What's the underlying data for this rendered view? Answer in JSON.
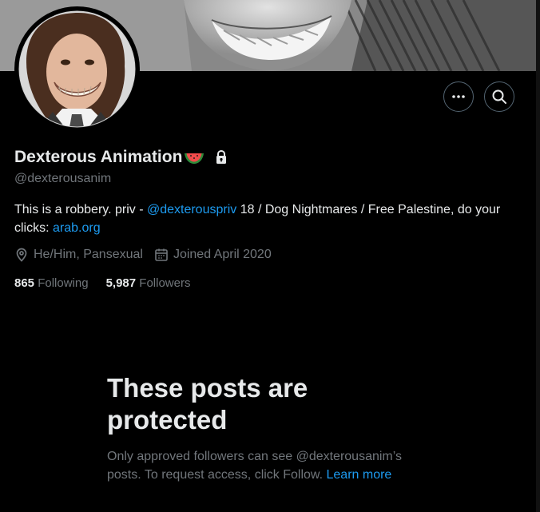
{
  "profile": {
    "display_name": "Dexterous Animation",
    "handle": "@dexterousanim",
    "bio_prefix": "This is a robbery. priv - ",
    "bio_link": "@dexterouspriv",
    "bio_middle": " 18 / Dog Nightmares / Free Palestine, do your clicks: ",
    "bio_url": "arab.org",
    "location": "He/Him, Pansexual",
    "joined": "Joined April 2020",
    "following_count": "865",
    "following_label": "Following",
    "followers_count": "5,987",
    "followers_label": "Followers"
  },
  "protected": {
    "title": "These posts are protected",
    "text": "Only approved followers can see @dexterousanim’s posts. To request access, click Follow.",
    "link": "Learn more"
  },
  "icons": {
    "more": "more-horizontal-icon",
    "search": "search-icon",
    "lock": "lock-icon",
    "location": "location-pin-icon",
    "calendar": "calendar-icon",
    "watermelon": "watermelon-emoji"
  },
  "colors": {
    "background": "#000000",
    "text_primary": "#e7e9ea",
    "text_secondary": "#71767b",
    "link": "#1d9bf0",
    "border": "#536471"
  }
}
